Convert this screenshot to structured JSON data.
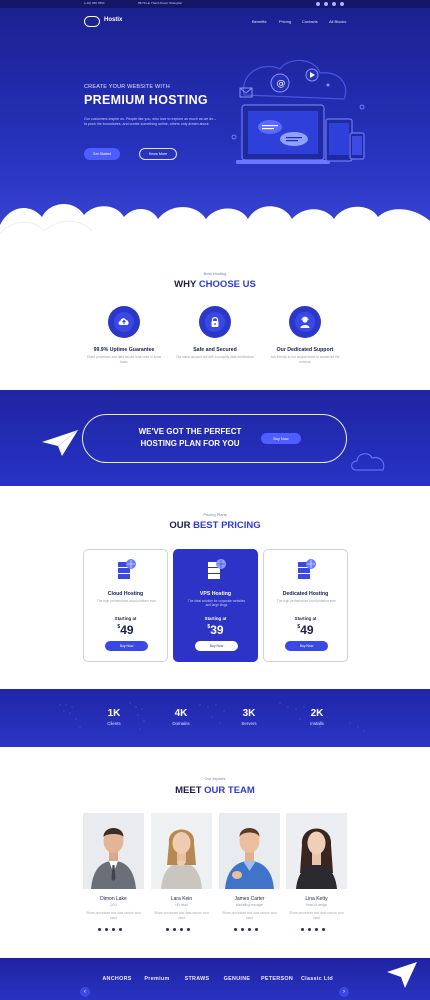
{
  "topbar": {
    "phone": "(+01) 456 7890",
    "address": "85/76 Ho Thanh Road, Shanghai"
  },
  "header": {
    "brand": "Hostix",
    "nav": [
      "Benefits",
      "Pricing",
      "Contacts",
      "All Blocks"
    ]
  },
  "hero": {
    "kicker": "CREATE YOUR WEBSITE WITH",
    "title": "PREMIUM HOSTING",
    "description": "Our customers inspire us. People like you, who love to explore as much as we do – to push the boundaries, and create something online, others only dream about.",
    "primary_button": "Get Started",
    "secondary_button": "Know More"
  },
  "why": {
    "kicker": "Best Hosting",
    "title_plain": "WHY",
    "title_accent": "CHOOSE US",
    "features": [
      {
        "icon": "cloud-upload-icon",
        "title": "99.9% Uptime Guarantee",
        "desc": "Share processes and data secure lona need to know basis"
      },
      {
        "icon": "lock-icon",
        "title": "Safe and Secured",
        "desc": "Our latest account will with a uniquely data architecture"
      },
      {
        "icon": "support-agent-icon",
        "title": "Our Dedicated Support",
        "desc": "Ask friendly to our support team to customize the network"
      }
    ]
  },
  "plan_band": {
    "line1": "WE'VE GOT THE PERFECT",
    "line2": "HOSTING PLAN FOR YOU",
    "button": "Buy Now"
  },
  "pricing": {
    "kicker": "Pricing Plans",
    "title_plain": "OUR",
    "title_accent": "BEST PRICING",
    "plans": [
      {
        "name": "Cloud Hosting",
        "desc": "The high performance cloud platform ever",
        "from": "Starting at",
        "currency": "$",
        "price": "49",
        "button": "Buy Now"
      },
      {
        "name": "VPS Hosting",
        "desc": "The ideal solution for corporate websites and large blogs",
        "from": "Starting at",
        "currency": "$",
        "price": "39",
        "button": "Buy Now"
      },
      {
        "name": "Dedicated Hosting",
        "desc": "The high performance cloud platform ever",
        "from": "Starting at",
        "currency": "$",
        "price": "49",
        "button": "Buy Now"
      }
    ]
  },
  "stats": [
    {
      "value": "1K",
      "label": "Clients"
    },
    {
      "value": "4K",
      "label": "Domains"
    },
    {
      "value": "3K",
      "label": "Servers"
    },
    {
      "value": "2K",
      "label": "Installs"
    }
  ],
  "team": {
    "kicker": "Our experts",
    "title_plain": "MEET",
    "title_accent": "OUR TEAM",
    "members": [
      {
        "name": "Dimon Lake",
        "role": "CEO",
        "desc": "Share processes and data secure lona need"
      },
      {
        "name": "Lara Kein",
        "role": "HR head",
        "desc": "Share processes and data secure lona need"
      },
      {
        "name": "James Carter",
        "role": "Marketing manager",
        "desc": "Share processes and data secure lona need"
      },
      {
        "name": "Lina Ketty",
        "role": "Head of design",
        "desc": "Share processes and data secure lona need"
      }
    ]
  },
  "clients": {
    "logos": [
      "ANCHORS",
      "Premium",
      "STRAWS",
      "GENUINE",
      "PETERSON",
      "Classic Ltd"
    ],
    "prev": "‹",
    "next": "›"
  },
  "colors": {
    "brand_dark": "#1b1f8e",
    "brand": "#2f3bd9",
    "accent_button": "#4f5cff",
    "text_dark": "#1b1e4b"
  }
}
